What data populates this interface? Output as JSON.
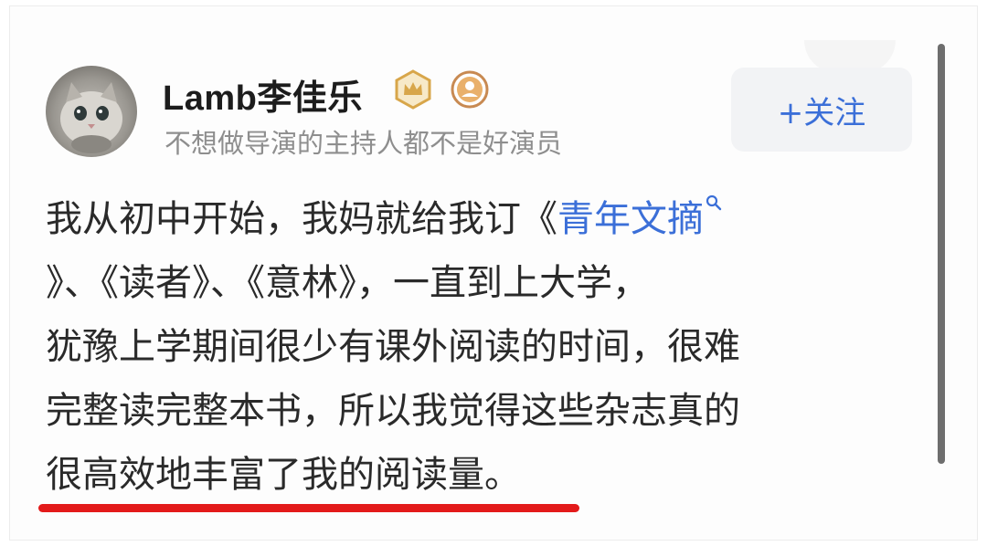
{
  "user": {
    "name": "Lamb李佳乐",
    "signature": "不想做导演的主持人都不是好演员"
  },
  "follow_button": {
    "label": "+关注"
  },
  "post": {
    "line1_text": "我从初中开始，我妈就给我订《",
    "line1_link": "青年文摘",
    "line2": "》、《读者》、《意林》，一直到上大学，",
    "line3": "犹豫上学期间很少有课外阅读的时间，很难",
    "line4": "完整读完整本书，所以我觉得这些杂志真的",
    "line5": "很高效地丰富了我的阅读量。"
  },
  "colors": {
    "link": "#3b6fd8",
    "underline": "#e31a1a",
    "badge_gold": "#d8a64a"
  },
  "icons": [
    "avatar-cat",
    "crown-badge-icon",
    "person-badge-icon",
    "search-icon"
  ]
}
